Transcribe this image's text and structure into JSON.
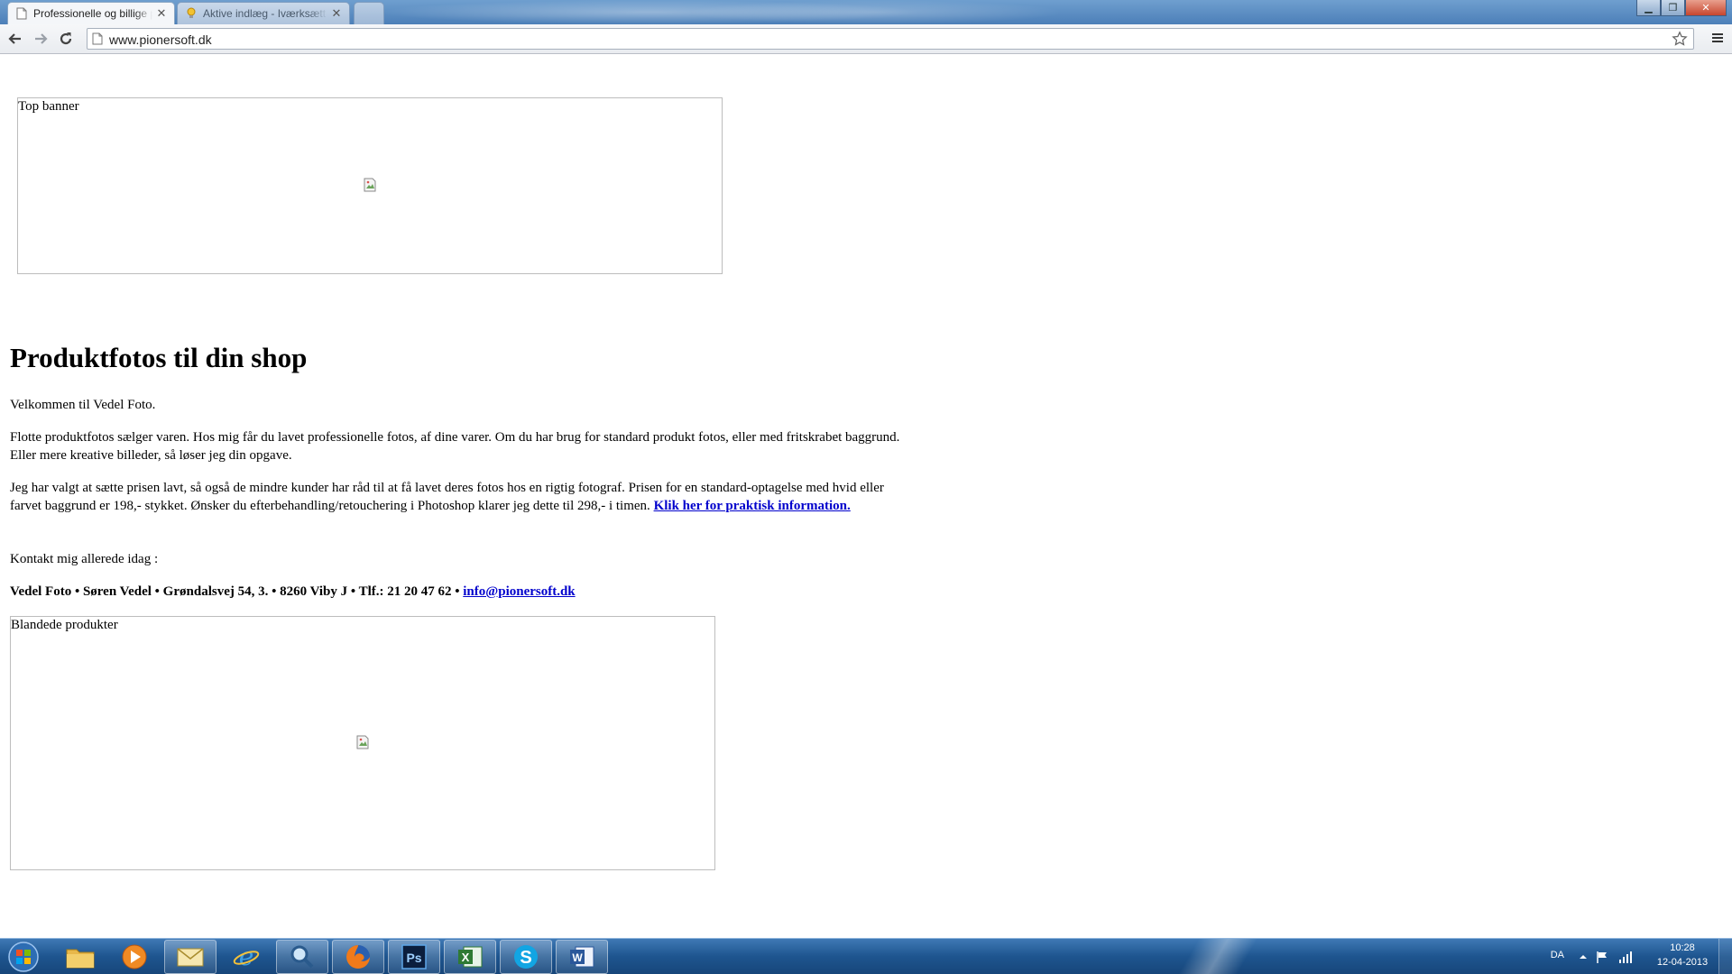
{
  "browser": {
    "tabs": [
      {
        "title": "Professionelle og billige p",
        "active": true,
        "icon": "page-icon"
      },
      {
        "title": "Aktive indlæg - Iværksætt",
        "active": false,
        "icon": "lightbulb-icon"
      }
    ],
    "address_bar": {
      "url": "www.pionersoft.dk"
    }
  },
  "page": {
    "top_banner": {
      "label": "Top banner"
    },
    "headline": "Produktfotos til din shop",
    "welcome": "Velkommen til Vedel Foto.",
    "intro_line1": "Flotte produktfotos sælger varen. Hos mig får du lavet professionelle fotos, af dine varer. Om du har brug for standard produkt fotos, eller med fritskrabet baggrund.",
    "intro_line2": "Eller mere kreative billeder, så løser jeg din opgave.",
    "price_line1": "Jeg har valgt at sætte prisen lavt, så også de mindre kunder har råd til at få lavet deres fotos hos en rigtig fotograf. Prisen for en standard-optagelse med hvid eller",
    "price_line2": "farvet baggrund er 198,- stykket. Ønsker du efterbehandling/retouchering i Photoshop klarer jeg dette til 298,- i timen.",
    "practical_info_link": "Klik her for praktisk information.",
    "contact_intro": "Kontakt mig allerede idag :",
    "address": "Vedel Foto • Søren Vedel • Grøndalsvej 54, 3. • 8260 Viby J • Tlf.: 21 20 47 62 •",
    "email_link": "info@pionersoft.dk",
    "mixed_products": {
      "label": "Blandede produkter"
    }
  },
  "taskbar": {
    "apps": [
      "windows-explorer",
      "media-player",
      "outlook",
      "internet-explorer",
      "search",
      "firefox",
      "photoshop",
      "excel",
      "skype",
      "word"
    ],
    "tray": {
      "language": "DA",
      "time": "10:28",
      "date": "12-04-2013"
    }
  }
}
